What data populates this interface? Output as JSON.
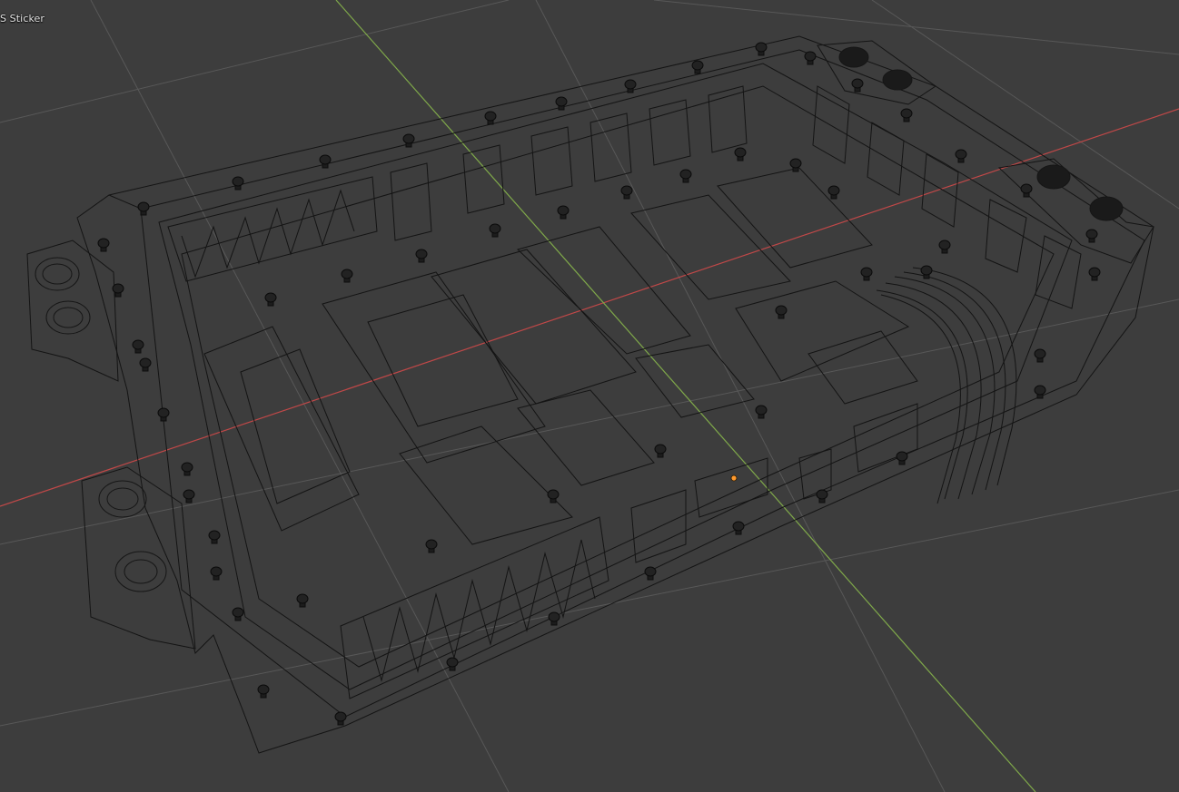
{
  "viewport": {
    "object_label": "S Sticker",
    "mode": "wireframe",
    "colors": {
      "background": "#3d3d3d",
      "grid": "#585858",
      "axis_x": "#c04848",
      "axis_y": "#7fa84a",
      "wire": "#101010",
      "origin": "#ff9a2e"
    },
    "icons": {
      "origin_marker": "object-origin-icon"
    }
  }
}
